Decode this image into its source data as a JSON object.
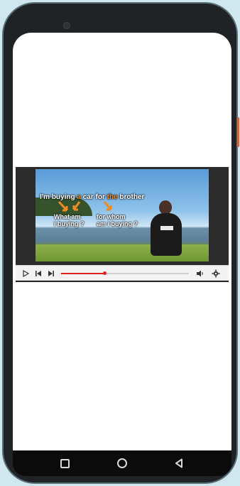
{
  "video": {
    "caption_parts": [
      "I'm buying ",
      "a",
      " car for ",
      "the",
      " brother"
    ],
    "question_left": [
      "What am",
      "i buying ?"
    ],
    "question_right": [
      "for whom",
      "am i buying ?"
    ],
    "shirt_text": "",
    "highlight_color": "#f08a24"
  },
  "player": {
    "progress": 0.34,
    "accent": "#e0211b",
    "icons": [
      "play-icon",
      "previous-icon",
      "next-icon",
      "volume-icon",
      "settings-icon"
    ]
  },
  "navbar": {
    "icons": [
      "recents-icon",
      "home-icon",
      "back-icon"
    ]
  }
}
